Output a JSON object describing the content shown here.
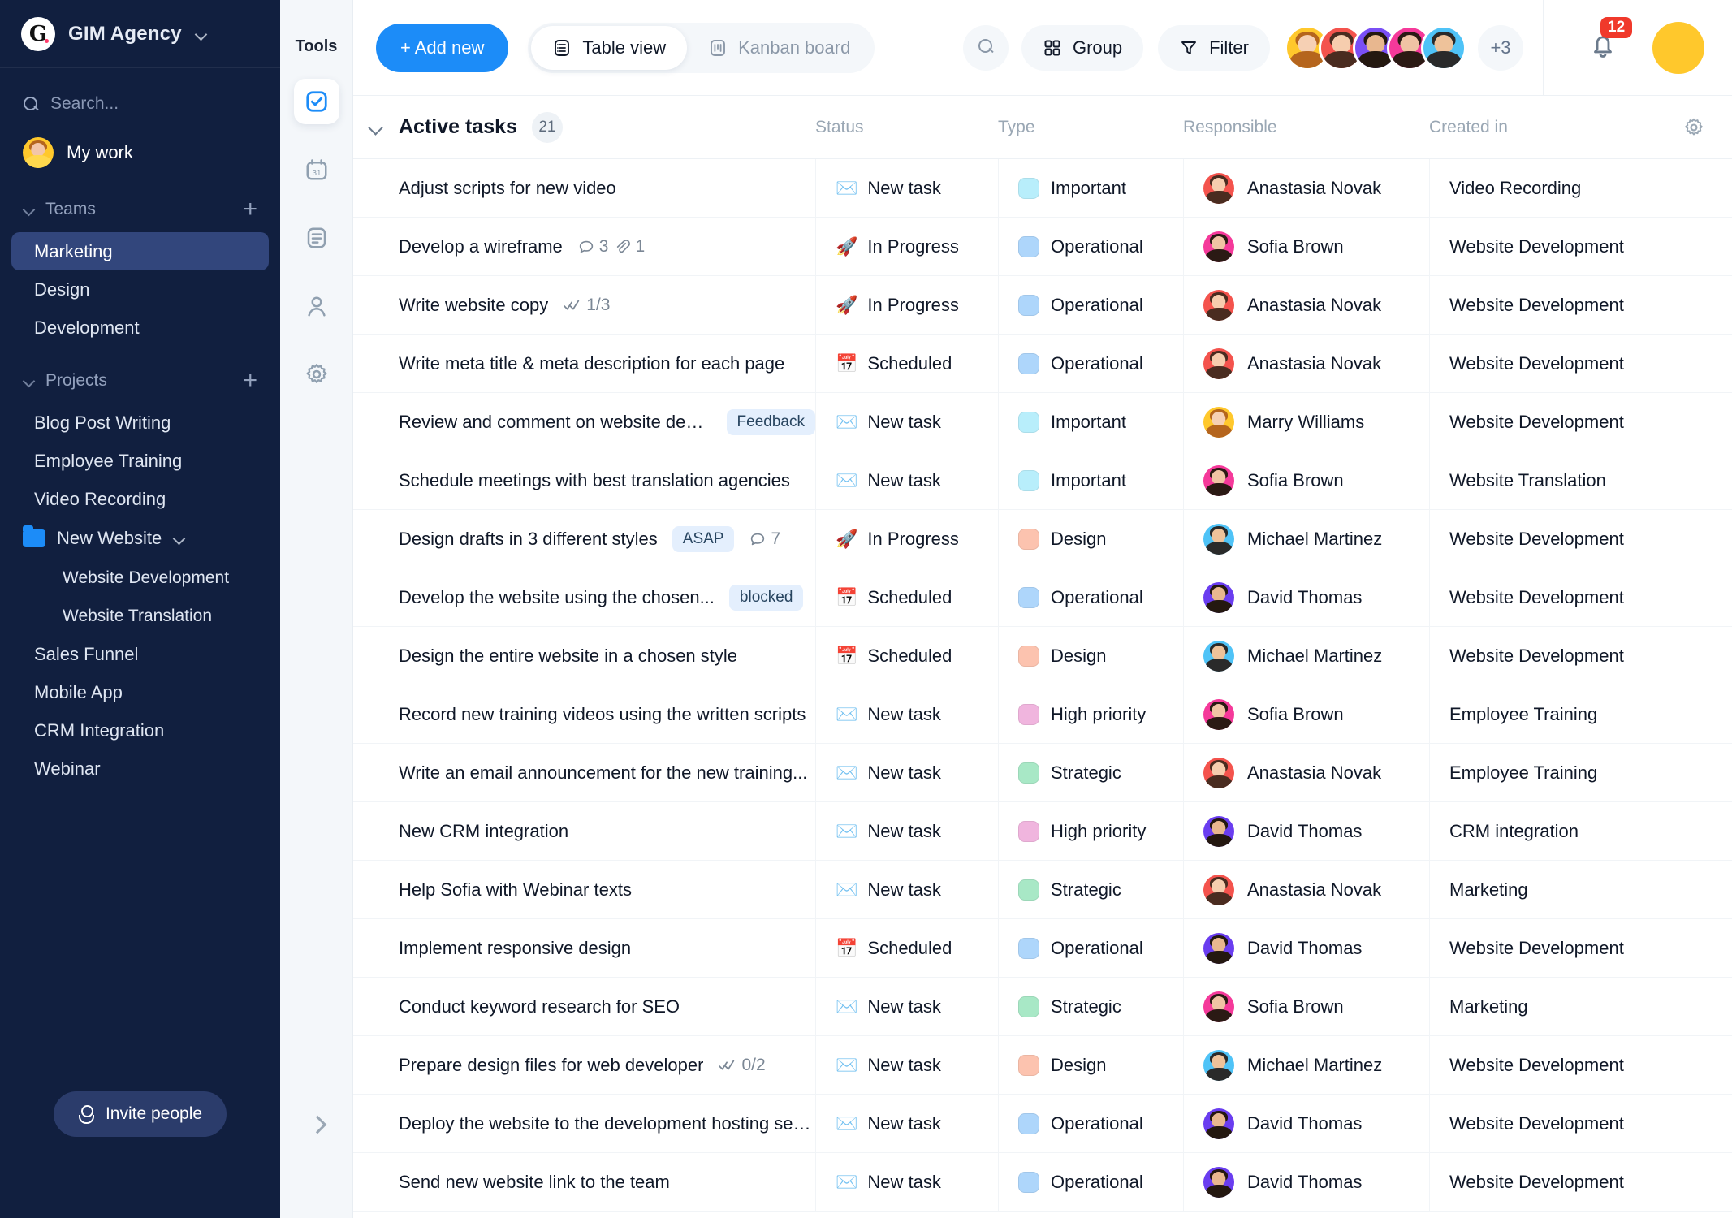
{
  "sidebar": {
    "brand": {
      "logo_letter": "G",
      "name": "GIM Agency",
      "chevron": "chevron-down-icon"
    },
    "search": {
      "placeholder": "Search..."
    },
    "my_work": {
      "label": "My work"
    },
    "teams": {
      "label": "Teams",
      "add": "+",
      "items": [
        {
          "label": "Marketing",
          "active": true
        },
        {
          "label": "Design",
          "active": false
        },
        {
          "label": "Development",
          "active": false
        }
      ]
    },
    "projects": {
      "label": "Projects",
      "add": "+",
      "items": [
        {
          "label": "Blog Post Writing",
          "type": "item"
        },
        {
          "label": "Employee Training",
          "type": "item"
        },
        {
          "label": "Video Recording",
          "type": "item"
        },
        {
          "label": "New Website",
          "type": "folder"
        },
        {
          "label": "Website Development",
          "type": "sub"
        },
        {
          "label": "Website Translation",
          "type": "sub"
        },
        {
          "label": "Sales Funnel",
          "type": "item"
        },
        {
          "label": "Mobile App",
          "type": "item"
        },
        {
          "label": "CRM Integration",
          "type": "item"
        },
        {
          "label": "Webinar",
          "type": "item"
        }
      ]
    },
    "invite": {
      "label": "Invite people"
    }
  },
  "tools": {
    "title": "Tools",
    "items": [
      {
        "icon": "checkbox-icon",
        "selected": true
      },
      {
        "icon": "calendar-icon",
        "selected": false
      },
      {
        "icon": "document-icon",
        "selected": false
      },
      {
        "icon": "person-icon",
        "selected": false
      },
      {
        "icon": "gear-icon",
        "selected": false
      }
    ],
    "collapse": "chevron-right-icon"
  },
  "topbar": {
    "add_new": "+ Add new",
    "views": [
      {
        "label": "Table view",
        "icon": "table-icon",
        "active": true
      },
      {
        "label": "Kanban board",
        "icon": "kanban-icon",
        "active": false
      }
    ],
    "search_icon": "search-icon",
    "group": "Group",
    "filter": "Filter",
    "avatars_overflow": "+3",
    "notifications_count": "12"
  },
  "table": {
    "group_title": "Active tasks",
    "group_count": "21",
    "columns": [
      "Status",
      "Type",
      "Responsible",
      "Created in"
    ],
    "colors": {
      "Important": "#b8eefb",
      "Operational": "#aed6fb",
      "Design": "#fcc3af",
      "High priority": "#f0b5de",
      "Strategic": "#a8e8c6"
    },
    "status_icons": {
      "New task": "✉️",
      "In Progress": "🚀",
      "Scheduled": "📅"
    },
    "rows": [
      {
        "name": "Adjust scripts for new video",
        "tag": "",
        "comments": "",
        "attachments": "",
        "checklist": "",
        "status": "New task",
        "type": "Important",
        "responsible": "Anastasia Novak",
        "created": "Video Recording"
      },
      {
        "name": "Develop a wireframe",
        "tag": "",
        "comments": "3",
        "attachments": "1",
        "checklist": "",
        "status": "In Progress",
        "type": "Operational",
        "responsible": "Sofia Brown",
        "created": "Website Development"
      },
      {
        "name": "Write website copy",
        "tag": "",
        "comments": "",
        "attachments": "",
        "checklist": "1/3",
        "status": "In Progress",
        "type": "Operational",
        "responsible": "Anastasia Novak",
        "created": "Website Development"
      },
      {
        "name": "Write meta title & meta description for each page",
        "tag": "",
        "comments": "",
        "attachments": "",
        "checklist": "",
        "status": "Scheduled",
        "type": "Operational",
        "responsible": "Anastasia Novak",
        "created": "Website Development"
      },
      {
        "name": "Review and comment on website design",
        "tag": "Feedback",
        "comments": "",
        "attachments": "",
        "checklist": "",
        "status": "New task",
        "type": "Important",
        "responsible": "Marry Williams",
        "created": "Website Development"
      },
      {
        "name": "Schedule meetings with best translation agencies",
        "tag": "",
        "comments": "",
        "attachments": "",
        "checklist": "",
        "status": "New task",
        "type": "Important",
        "responsible": "Sofia Brown",
        "created": "Website Translation"
      },
      {
        "name": "Design drafts in 3 different styles",
        "tag": "ASAP",
        "comments": "7",
        "attachments": "",
        "checklist": "",
        "status": "In Progress",
        "type": "Design",
        "responsible": "Michael Martinez",
        "created": "Website Development"
      },
      {
        "name": "Develop the website using the chosen...",
        "tag": "blocked",
        "comments": "",
        "attachments": "",
        "checklist": "",
        "status": "Scheduled",
        "type": "Operational",
        "responsible": "David Thomas",
        "created": "Website Development"
      },
      {
        "name": "Design the entire website in a chosen style",
        "tag": "",
        "comments": "",
        "attachments": "",
        "checklist": "",
        "status": "Scheduled",
        "type": "Design",
        "responsible": "Michael Martinez",
        "created": "Website Development"
      },
      {
        "name": "Record new training videos using the written scripts",
        "tag": "",
        "comments": "",
        "attachments": "",
        "checklist": "",
        "status": "New task",
        "type": "High priority",
        "responsible": "Sofia Brown",
        "created": "Employee Training"
      },
      {
        "name": "Write an email announcement for the new training...",
        "tag": "",
        "comments": "",
        "attachments": "",
        "checklist": "",
        "status": "New task",
        "type": "Strategic",
        "responsible": "Anastasia Novak",
        "created": "Employee Training"
      },
      {
        "name": "New CRM integration",
        "tag": "",
        "comments": "",
        "attachments": "",
        "checklist": "",
        "status": "New task",
        "type": "High priority",
        "responsible": "David Thomas",
        "created": "CRM integration"
      },
      {
        "name": "Help Sofia with Webinar texts",
        "tag": "",
        "comments": "",
        "attachments": "",
        "checklist": "",
        "status": "New task",
        "type": "Strategic",
        "responsible": "Anastasia Novak",
        "created": "Marketing"
      },
      {
        "name": "Implement responsive design",
        "tag": "",
        "comments": "",
        "attachments": "",
        "checklist": "",
        "status": "Scheduled",
        "type": "Operational",
        "responsible": "David Thomas",
        "created": "Website Development"
      },
      {
        "name": "Conduct keyword research for SEO",
        "tag": "",
        "comments": "",
        "attachments": "",
        "checklist": "",
        "status": "New task",
        "type": "Strategic",
        "responsible": "Sofia Brown",
        "created": "Marketing"
      },
      {
        "name": "Prepare design files for web developer",
        "tag": "",
        "comments": "",
        "attachments": "",
        "checklist": "0/2",
        "status": "New task",
        "type": "Design",
        "responsible": "Michael Martinez",
        "created": "Website Development"
      },
      {
        "name": "Deploy the website to the development hosting server",
        "tag": "",
        "comments": "",
        "attachments": "",
        "checklist": "",
        "status": "New task",
        "type": "Operational",
        "responsible": "David Thomas",
        "created": "Website Development"
      },
      {
        "name": "Send new website link to the team",
        "tag": "",
        "comments": "",
        "attachments": "",
        "checklist": "",
        "status": "New task",
        "type": "Operational",
        "responsible": "David Thomas",
        "created": "Website Development"
      }
    ],
    "people_colors": {
      "Anastasia Novak": {
        "bg": "#f4534d",
        "hair": "#4a2c20",
        "skin": "#f6cdae"
      },
      "Sofia Brown": {
        "bg": "#f5399a",
        "hair": "#2b1a14",
        "skin": "#f0c3a4"
      },
      "Marry Williams": {
        "bg": "#ffc82c",
        "hair": "#b5651d",
        "skin": "#f6d0b4"
      },
      "Michael Martinez": {
        "bg": "#4fc3f7",
        "hair": "#2a2a2a",
        "skin": "#eec29a"
      },
      "David Thomas": {
        "bg": "#6a3df0",
        "hair": "#241810",
        "skin": "#e8b78f"
      }
    },
    "header_avatars": [
      {
        "bg": "#ffc82c",
        "hair": "#b5651d",
        "skin": "#f6d0b4"
      },
      {
        "bg": "#f4534d",
        "hair": "#4a2c20",
        "skin": "#f6cdae"
      },
      {
        "bg": "#7a4ff5",
        "hair": "#241810",
        "skin": "#e8b78f"
      },
      {
        "bg": "#f5399a",
        "hair": "#2b1a14",
        "skin": "#f0c3a4"
      },
      {
        "bg": "#4fc3f7",
        "hair": "#2a2a2a",
        "skin": "#eec29a"
      }
    ]
  }
}
